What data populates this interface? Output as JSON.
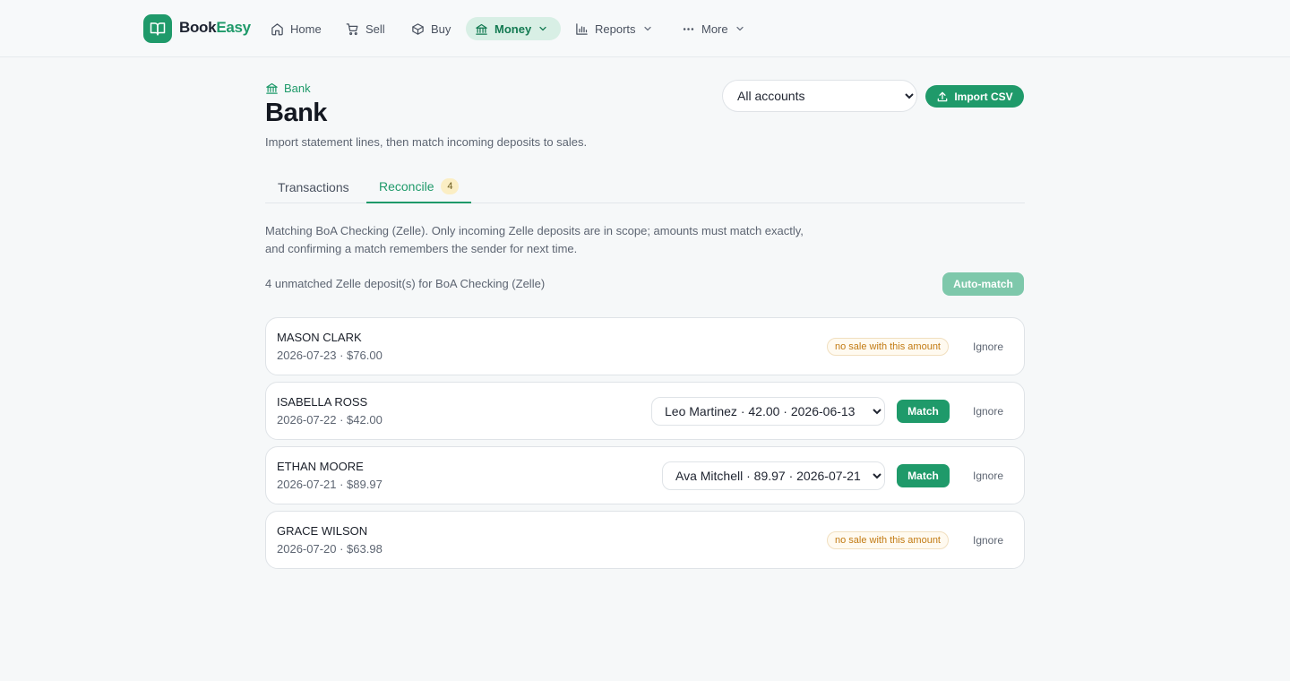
{
  "brand": {
    "name_part1": "Book",
    "name_part2": "Easy",
    "accent_color": "#1f9a6a"
  },
  "nav": [
    {
      "label": "Home",
      "icon": "home-icon"
    },
    {
      "label": "Sell",
      "icon": "cart-icon"
    },
    {
      "label": "Buy",
      "icon": "box-icon"
    },
    {
      "label": "Money",
      "icon": "bank-icon",
      "active": true
    },
    {
      "label": "Reports",
      "icon": "bar-chart-icon"
    },
    {
      "label": "More",
      "icon": "dots-icon"
    }
  ],
  "page": {
    "breadcrumb": "Bank",
    "title": "Bank",
    "subtitle": "Import statement lines, then match incoming deposits to sales.",
    "account_select": "All accounts",
    "import_label": "Import CSV"
  },
  "tabs": [
    {
      "label": "Transactions"
    },
    {
      "label": "Reconcile",
      "badge": "4",
      "active": true
    }
  ],
  "reconcile": {
    "scope_line1": "Matching BoA Checking (Zelle). Only incoming Zelle deposits are in scope; amounts must match exactly,",
    "scope_line2": "and confirming a match remembers the sender for next time.",
    "count_text": "4 unmatched Zelle deposit(s) for BoA Checking (Zelle)",
    "auto_match_label": "Auto-match",
    "match_label": "Match",
    "ignore_label": "Ignore",
    "no_sale_label": "no sale with this amount",
    "deposits": [
      {
        "name": "MASON CLARK",
        "meta": "2026-07-23 · $76.00"
      },
      {
        "name": "ISABELLA ROSS",
        "meta": "2026-07-22 · $42.00",
        "sale": "Leo Martinez · 42.00 · 2026-06-13"
      },
      {
        "name": "ETHAN MOORE",
        "meta": "2026-07-21 · $89.97",
        "sale": "Ava Mitchell · 89.97 · 2026-07-21"
      },
      {
        "name": "GRACE WILSON",
        "meta": "2026-07-20 · $63.98"
      }
    ]
  }
}
